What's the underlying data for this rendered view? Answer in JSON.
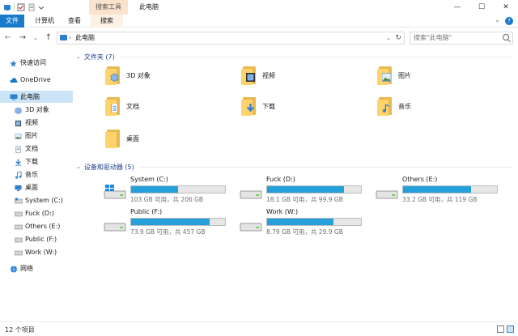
{
  "window": {
    "title": "此电脑",
    "context_tab": "搜索工具",
    "minimize_glyph": "—",
    "maximize_glyph": "☐",
    "close_glyph": "✕"
  },
  "ribbon": {
    "tabs": [
      {
        "label": "文件"
      },
      {
        "label": "计算机"
      },
      {
        "label": "查看"
      },
      {
        "label": "搜索"
      }
    ],
    "help_glyph": "?"
  },
  "address": {
    "back_glyph": "←",
    "forward_glyph": "→",
    "recent_glyph": "⌄",
    "up_glyph": "↑",
    "separator": "›",
    "path": "此电脑",
    "dropdown_glyph": "⌄",
    "refresh_glyph": "↻",
    "search_placeholder": "搜索\"此电脑\""
  },
  "sidebar": {
    "items": [
      {
        "label": "快速访问",
        "icon": "star-icon"
      },
      {
        "label": "OneDrive",
        "icon": "cloud-icon"
      },
      {
        "label": "此电脑",
        "icon": "computer-icon",
        "selected": true
      },
      {
        "label": "3D 对象",
        "icon": "cube-icon"
      },
      {
        "label": "视频",
        "icon": "video-icon"
      },
      {
        "label": "图片",
        "icon": "picture-icon"
      },
      {
        "label": "文档",
        "icon": "document-icon"
      },
      {
        "label": "下载",
        "icon": "download-icon"
      },
      {
        "label": "音乐",
        "icon": "music-icon"
      },
      {
        "label": "桌面",
        "icon": "desktop-icon"
      },
      {
        "label": "System (C:)",
        "icon": "drive-icon"
      },
      {
        "label": "Fuck (D:)",
        "icon": "drive-icon"
      },
      {
        "label": "Others (E:)",
        "icon": "drive-icon"
      },
      {
        "label": "Public (F:)",
        "icon": "drive-icon"
      },
      {
        "label": "Work (W:)",
        "icon": "drive-icon"
      },
      {
        "label": "网络",
        "icon": "network-icon"
      }
    ]
  },
  "folders_group": {
    "title": "文件夹 (7)",
    "items": [
      {
        "label": "3D 对象",
        "icon": "cube-folder-icon"
      },
      {
        "label": "视频",
        "icon": "video-folder-icon"
      },
      {
        "label": "图片",
        "icon": "picture-folder-icon"
      },
      {
        "label": "文档",
        "icon": "document-folder-icon"
      },
      {
        "label": "下载",
        "icon": "download-folder-icon"
      },
      {
        "label": "音乐",
        "icon": "music-folder-icon"
      },
      {
        "label": "桌面",
        "icon": "desktop-folder-icon"
      }
    ]
  },
  "drives_group": {
    "title": "设备和驱动器 (5)",
    "items": [
      {
        "name": "System (C:)",
        "size": "103 GB 可用，共 206 GB",
        "used_fraction": 0.5,
        "windows": true
      },
      {
        "name": "Fuck (D:)",
        "size": "18.1 GB 可用，共 99.9 GB",
        "used_fraction": 0.82
      },
      {
        "name": "Others (E:)",
        "size": "33.2 GB 可用，共 119 GB",
        "used_fraction": 0.72
      },
      {
        "name": "Public (F:)",
        "size": "73.9 GB 可用，共 457 GB",
        "used_fraction": 0.84
      },
      {
        "name": "Work (W:)",
        "size": "8.79 GB 可用，共 29.9 GB",
        "used_fraction": 0.71
      }
    ]
  },
  "status": {
    "count": "12 个项目"
  },
  "colors": {
    "accent": "#1979ca",
    "drive_bar": "#26a0da",
    "folder": "#ffd36b",
    "selection": "#cce4f7"
  }
}
